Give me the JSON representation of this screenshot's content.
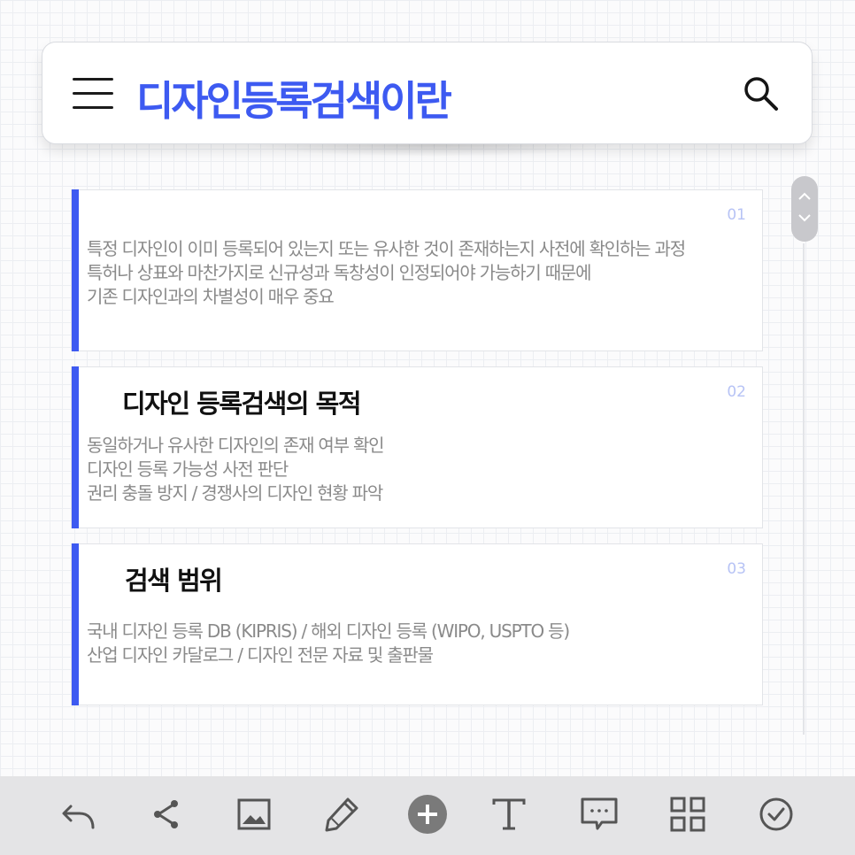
{
  "header": {
    "title": "디자인등록검색이란"
  },
  "icons": {
    "menu": "menu-icon",
    "search": "search-icon",
    "scroll": "scroll-up-down-icon"
  },
  "colors": {
    "accent": "#3d5af1",
    "number": "#b7c3f5",
    "body_text": "#8a8a8a",
    "toolbar_bg": "#e4e4e6",
    "toolbar_icon": "#555555"
  },
  "cards": [
    {
      "number": "01",
      "heading": "",
      "lines": [
        "특정 디자인이 이미 등록되어 있는지 또는 유사한 것이 존재하는지 사전에 확인하는 과정",
        "특허나 상표와 마찬가지로 신규성과 독창성이 인정되어야 가능하기 때문에",
        "기존 디자인과의 차별성이 매우 중요"
      ]
    },
    {
      "number": "02",
      "heading": "디자인 등록검색의 목적",
      "lines": [
        "동일하거나 유사한 디자인의 존재 여부 확인",
        "디자인 등록 가능성 사전 판단",
        "권리 충돌 방지 / 경쟁사의 디자인 현황 파악"
      ]
    },
    {
      "number": "03",
      "heading": "검색 범위",
      "lines": [
        "국내 디자인 등록 DB (KIPRIS) / 해외 디자인 등록 (WIPO, USPTO 등)",
        "산업 디자인 카달로그 / 디자인 전문 자료 및 출판물"
      ]
    }
  ],
  "toolbar": {
    "items": [
      "undo-icon",
      "share-icon",
      "image-icon",
      "pencil-icon",
      "add-circle-icon",
      "text-icon",
      "comment-icon",
      "grid-icon",
      "check-circle-icon"
    ]
  }
}
